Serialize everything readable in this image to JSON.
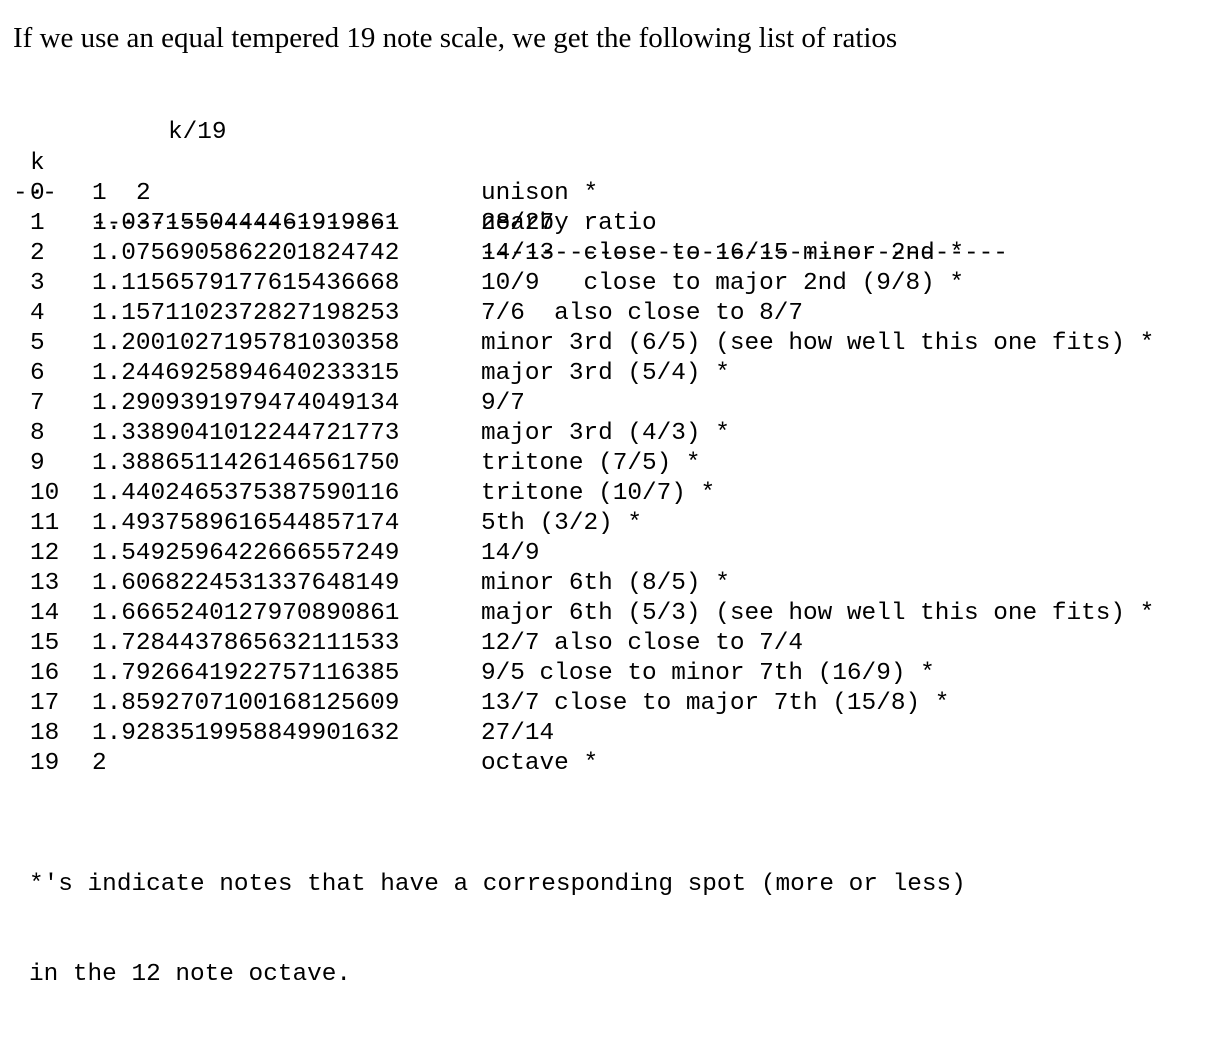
{
  "intro": "If we use an equal tempered 19 note scale, we get the following list of ratios",
  "header": {
    "exponent": "k/19",
    "k_label": "k",
    "base": "2",
    "ratio_label": "nearby ratio",
    "rule_k": "---",
    "rule_value": "---------------------",
    "rule_ratio": "------------------------------------"
  },
  "rows": [
    {
      "k": "0",
      "value": "1",
      "ratio": "unison *"
    },
    {
      "k": "1",
      "value": "1.0371550444461919861",
      "ratio": "28/27"
    },
    {
      "k": "2",
      "value": "1.0756905862201824742",
      "ratio": "14/13  close to 16/15 minor 2nd *"
    },
    {
      "k": "3",
      "value": "1.1156579177615436668",
      "ratio": "10/9   close to major 2nd (9/8) *"
    },
    {
      "k": "4",
      "value": "1.1571102372827198253",
      "ratio": "7/6  also close to 8/7"
    },
    {
      "k": "5",
      "value": "1.2001027195781030358",
      "ratio": "minor 3rd (6/5) (see how well this one fits) *"
    },
    {
      "k": "6",
      "value": "1.2446925894640233315",
      "ratio": "major 3rd (5/4) *"
    },
    {
      "k": "7",
      "value": "1.2909391979474049134",
      "ratio": "9/7"
    },
    {
      "k": "8",
      "value": "1.3389041012244721773",
      "ratio": "major 3rd (4/3) *"
    },
    {
      "k": "9",
      "value": "1.3886511426146561750",
      "ratio": "tritone (7/5) *"
    },
    {
      "k": "10",
      "value": "1.4402465375387590116",
      "ratio": "tritone (10/7) *"
    },
    {
      "k": "11",
      "value": "1.4937589616544857174",
      "ratio": "5th (3/2) *"
    },
    {
      "k": "12",
      "value": "1.5492596422666557249",
      "ratio": "14/9"
    },
    {
      "k": "13",
      "value": "1.6068224531337648149",
      "ratio": "minor 6th (8/5) *"
    },
    {
      "k": "14",
      "value": "1.6665240127970890861",
      "ratio": "major 6th (5/3) (see how well this one fits) *"
    },
    {
      "k": "15",
      "value": "1.7284437865632111533",
      "ratio": "12/7 also close to 7/4"
    },
    {
      "k": "16",
      "value": "1.7926641922757116385",
      "ratio": "9/5 close to minor 7th (16/9) *"
    },
    {
      "k": "17",
      "value": "1.8592707100168125609",
      "ratio": "13/7 close to major 7th (15/8) *"
    },
    {
      "k": "18",
      "value": "1.9283519958849901632",
      "ratio": "27/14"
    },
    {
      "k": "19",
      "value": "2",
      "ratio": "octave *"
    }
  ],
  "footnote": {
    "line1": "*'s indicate notes that have a corresponding spot (more or less)",
    "line2": "in the 12 note octave."
  }
}
